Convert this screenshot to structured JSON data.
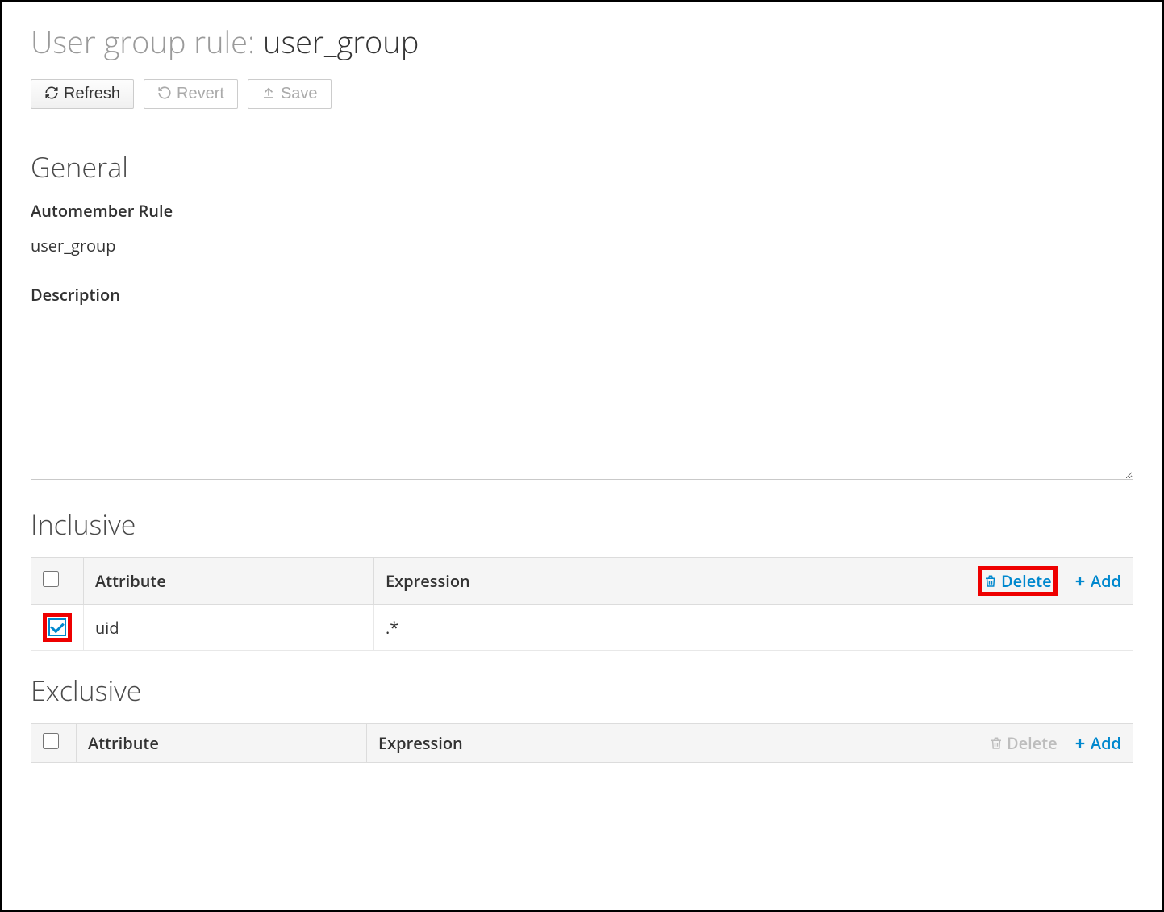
{
  "header": {
    "kind_label": "User group rule: ",
    "rule_name": "user_group"
  },
  "buttons": {
    "refresh": "Refresh",
    "revert": "Revert",
    "save": "Save"
  },
  "general": {
    "title": "General",
    "automember_label": "Automember Rule",
    "automember_value": "user_group",
    "description_label": "Description",
    "description_value": ""
  },
  "inclusive": {
    "title": "Inclusive",
    "columns": {
      "attribute": "Attribute",
      "expression": "Expression"
    },
    "actions": {
      "delete": "Delete",
      "add": "Add"
    },
    "rows": [
      {
        "attribute": "uid",
        "expression": ".*",
        "checked": true
      }
    ]
  },
  "exclusive": {
    "title": "Exclusive",
    "columns": {
      "attribute": "Attribute",
      "expression": "Expression"
    },
    "actions": {
      "delete": "Delete",
      "add": "Add"
    },
    "rows": []
  }
}
